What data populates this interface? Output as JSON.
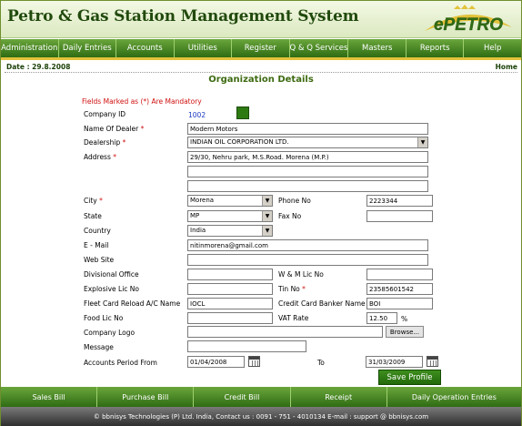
{
  "header": {
    "app_title": "Petro & Gas Station Management System",
    "logo_text": "ePETRO"
  },
  "nav": [
    {
      "label": "Administration"
    },
    {
      "label": "Daily Entries"
    },
    {
      "label": "Accounts"
    },
    {
      "label": "Utilities"
    },
    {
      "label": "Register"
    },
    {
      "label": "Q & Q Services"
    },
    {
      "label": "Masters"
    },
    {
      "label": "Reports"
    },
    {
      "label": "Help"
    }
  ],
  "date_text": "Date : 29.8.2008",
  "home_label": "Home",
  "page_title": "Organization Details",
  "mandatory_note": "Fields Marked as (*) Are Mandatory",
  "labels": {
    "company_id": "Company ID",
    "dealer_name": "Name Of Dealer",
    "dealership": "Dealership",
    "address": "Address",
    "city": "City",
    "phone": "Phone No",
    "state": "State",
    "fax": "Fax No",
    "country": "Country",
    "email": "E - Mail",
    "website": "Web Site",
    "divisional_office": "Divisional Office",
    "wm_lic": "W & M Lic No",
    "explosive_lic": "Explosive Lic No",
    "tin": "Tin No",
    "fleet_card": "Fleet Card Reload A/C Name",
    "credit_card_banker": "Credit Card Banker Name",
    "food_lic": "Food Lic No",
    "vat_rate": "VAT Rate",
    "company_logo": "Company Logo",
    "message": "Message",
    "accounts_period_from": "Accounts Period From",
    "to": "To"
  },
  "required_mark": "*",
  "percent_sign": "%",
  "values": {
    "company_id": "1002",
    "dealer_name": "Modern Motors",
    "dealership": "INDIAN OIL CORPORATION LTD.",
    "address1": "29/30, Nehru park, M.S.Road. Morena (M.P.)",
    "address2": "",
    "address3": "",
    "city": "Morena",
    "phone": "2223344",
    "state": "MP",
    "fax": "",
    "country": "India",
    "email": "nitinmorena@gmail.com",
    "website": "",
    "divisional_office": "",
    "wm_lic": "",
    "explosive_lic": "",
    "tin": "23585601542",
    "fleet_card": "IOCL",
    "credit_card_banker": "BOI",
    "food_lic": "",
    "vat_rate": "12.50",
    "company_logo": "",
    "message": "",
    "period_from": "01/04/2008",
    "period_to": "31/03/2009"
  },
  "buttons": {
    "browse": "Browse...",
    "save": "Save Profile"
  },
  "bottom_nav": [
    {
      "label": "Sales Bill"
    },
    {
      "label": "Purchase Bill"
    },
    {
      "label": "Credit Bill"
    },
    {
      "label": "Receipt"
    },
    {
      "label": "Daily Operation Entries"
    }
  ],
  "footer_text": "© bbnisys Technologies (P) Ltd. India, Contact us : 0091 - 751 - 4010134 E-mail : support @ bbnisys.com",
  "icons": {
    "dropdown": "chevron-down-icon",
    "calendar": "calendar-icon",
    "lookup": "lookup-icon"
  },
  "colors": {
    "brand_green": "#2f6c14",
    "nav_light": "#6aa63b",
    "title_green": "#214a0d",
    "required_red": "#d01010",
    "accent_gold": "#e3c23a",
    "link_blue": "#1a39c4"
  }
}
